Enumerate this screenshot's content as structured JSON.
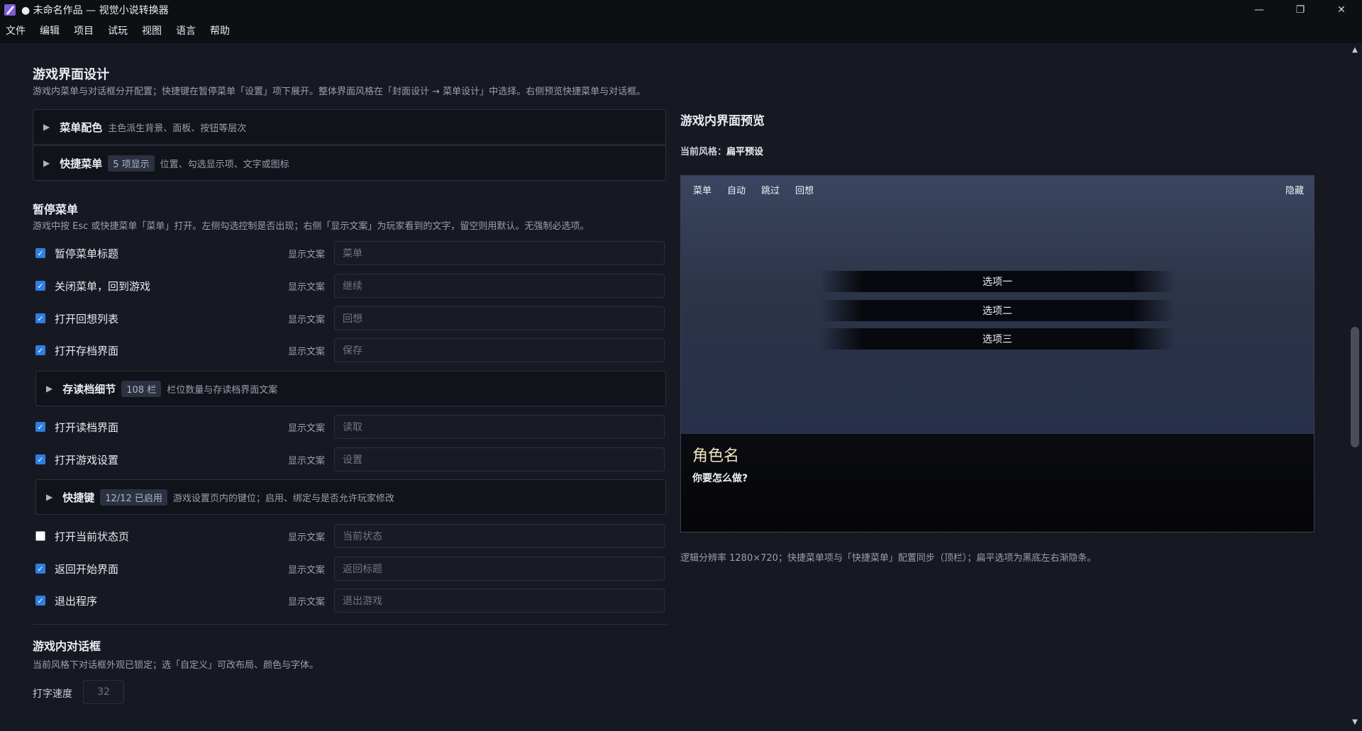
{
  "window": {
    "title": "● 未命名作品 — 视觉小说转换器",
    "controls": [
      "—",
      "❐",
      "✕"
    ]
  },
  "menubar": [
    "文件",
    "编辑",
    "项目",
    "试玩",
    "视图",
    "语言",
    "帮助"
  ],
  "ui_section": {
    "title": "游戏界面设计",
    "desc": "游戏内菜单与对话框分开配置；快捷键在暂停菜单「设置」项下展开。整体界面风格在「封面设计 → 菜单设计」中选择。右侧预览快捷菜单与对话框。"
  },
  "collapsibles": {
    "menu_color": {
      "title": "菜单配色",
      "desc": "主色派生背景、面板、按钮等层次"
    },
    "quick_menu": {
      "title": "快捷菜单",
      "badge": "5 项显示",
      "desc": "位置、勾选显示项、文字或图标"
    },
    "save_detail": {
      "title": "存读档细节",
      "badge": "108 栏",
      "desc": "栏位数量与存读档界面文案"
    },
    "hotkeys": {
      "title": "快捷键",
      "badge": "12/12 已启用",
      "desc": "游戏设置页内的键位；启用、绑定与是否允许玩家修改"
    }
  },
  "pause_menu": {
    "title": "暂停菜单",
    "desc": "游戏中按 Esc 或快捷菜单「菜单」打开。左侧勾选控制是否出现；右侧「显示文案」为玩家看到的文字，留空则用默认。无强制必选项。",
    "display_label": "显示文案",
    "items": [
      {
        "label": "暂停菜单标题",
        "checked": true,
        "placeholder": "菜单"
      },
      {
        "label": "关闭菜单，回到游戏",
        "checked": true,
        "placeholder": "继续"
      },
      {
        "label": "打开回想列表",
        "checked": true,
        "placeholder": "回想"
      },
      {
        "label": "打开存档界面",
        "checked": true,
        "placeholder": "保存"
      },
      {
        "label": "打开读档界面",
        "checked": true,
        "placeholder": "读取"
      },
      {
        "label": "打开游戏设置",
        "checked": true,
        "placeholder": "设置"
      },
      {
        "label": "打开当前状态页",
        "checked": false,
        "placeholder": "当前状态"
      },
      {
        "label": "返回开始界面",
        "checked": true,
        "placeholder": "返回标题"
      },
      {
        "label": "退出程序",
        "checked": true,
        "placeholder": "退出游戏"
      }
    ]
  },
  "dialog_section": {
    "title": "游戏内对话框",
    "desc": "当前风格下对话框外观已锁定；选「自定义」可改布局、颜色与字体。",
    "speed_label": "打字速度",
    "speed_value": "32"
  },
  "preview": {
    "title": "游戏内界面预览",
    "style_label": "当前风格：",
    "style_value": "扁平预设",
    "quick_menu": [
      "菜单",
      "自动",
      "跳过",
      "回想"
    ],
    "hide": "隐藏",
    "options": [
      "选项一",
      "选项二",
      "选项三"
    ],
    "speaker": "角色名",
    "line": "你要怎么做?",
    "note": "逻辑分辨率 1280×720；快捷菜单项与「快捷菜单」配置同步（顶栏）；扁平选项为黑底左右渐隐条。"
  },
  "colors": {
    "accent": "#2f7fe3",
    "background": "#171922",
    "panel": "#11131a"
  }
}
